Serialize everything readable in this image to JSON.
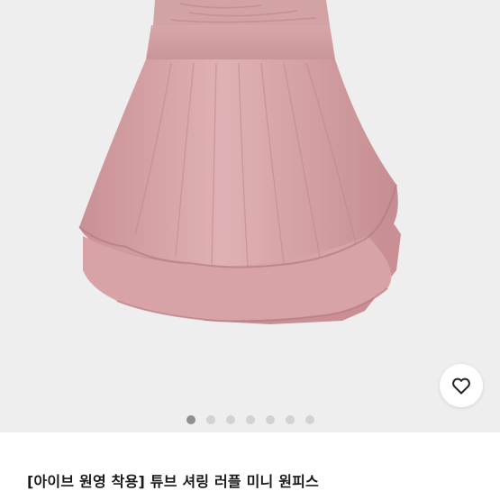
{
  "gallery": {
    "image_alt": "pink ruffle skirt",
    "dot_count": 7,
    "active_index": 0,
    "dot_active_color": "#8e8e8e",
    "dot_inactive_color": "#d2d2d2"
  },
  "wishlist": {
    "icon": "heart-outline-icon"
  },
  "product": {
    "title": "[아이브 원영 착용] 튜브 셔링 러플 미니 원피스"
  },
  "colors": {
    "skirt": "#d9a7aa",
    "background": "#efeeee"
  }
}
